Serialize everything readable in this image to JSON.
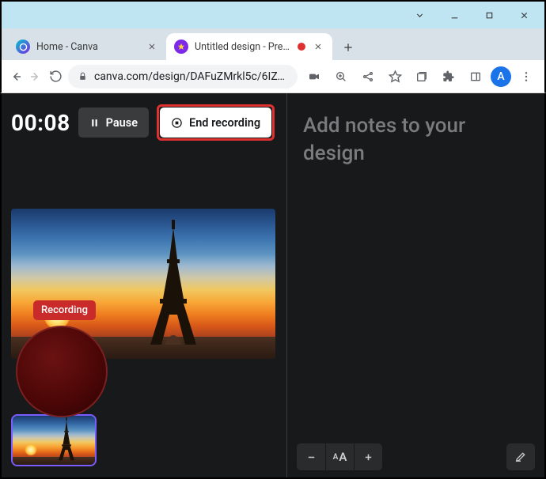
{
  "window": {
    "tabs": [
      {
        "title": "Home - Canva",
        "active": false
      },
      {
        "title": "Untitled design - Prese",
        "active": true,
        "recording": true
      }
    ],
    "url": "canva.com/design/DAFuZMrkl5c/6IZOHI…",
    "avatar_initial": "A"
  },
  "recorder": {
    "timer": "00:08",
    "pause_label": "Pause",
    "end_label": "End recording",
    "badge": "Recording"
  },
  "notes": {
    "placeholder": "Add notes to your design",
    "fontsize_label": "A",
    "fontsize_small": "A"
  }
}
